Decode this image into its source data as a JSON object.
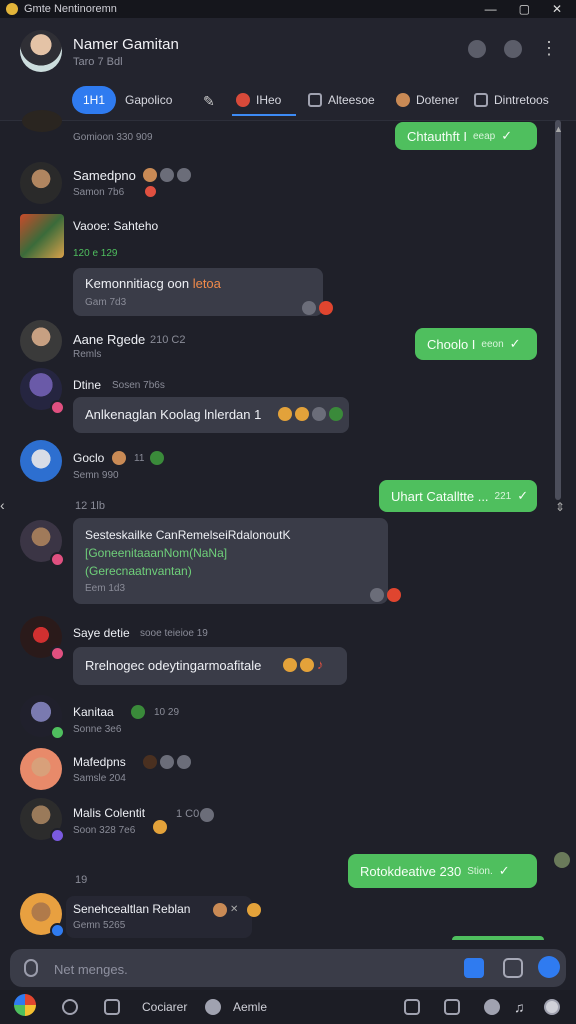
{
  "window": {
    "title": "Gmte Nentinoremn",
    "controls": [
      "—",
      "▢",
      "✕"
    ]
  },
  "header": {
    "name": "Namer Gamitan",
    "subtitle": "Taro 7 Bdl"
  },
  "tabs": [
    {
      "label": "1H1"
    },
    {
      "label": "Gapolico"
    },
    {
      "label": "IHeo"
    },
    {
      "label": "Alteesoe"
    },
    {
      "label": "Dotener"
    },
    {
      "label": "Dintretoos"
    }
  ],
  "messages": {
    "m0": {
      "time": "Gomioon 330 909"
    },
    "out1": {
      "text": "Chtauthft I",
      "time": "eeap",
      "status": "✓"
    },
    "m1": {
      "name": "Samedpno",
      "time": "Samon 7b6"
    },
    "m2": {
      "name": "Vaooe: Sahteho",
      "time": "120 e 129"
    },
    "b2": {
      "text": "Kemonnitiacg oon"
    },
    "b2b": {
      "text": "letoa",
      "time": "Gam 7d3"
    },
    "m3": {
      "name": "Aane Rgede",
      "extra": "210 C2",
      "time": "Remls"
    },
    "out2": {
      "text": "Choolo I",
      "time": "eeon",
      "status": "✓"
    },
    "m4": {
      "name": "Dtine",
      "extra": "Sosen 7b6s"
    },
    "b4": {
      "text": "Anlkenaglan Koolag lnlerdan 1"
    },
    "m5": {
      "name": "Goclo",
      "extra": "11",
      "time": "Semn 990"
    },
    "out3": {
      "text": "Uhart Catalltte ...",
      "time": "221",
      "status": "✓"
    },
    "m6": {
      "time": "12 1lb"
    },
    "b6": {
      "line1": "Sesteskailke CanRemelseiRdalonoutK",
      "line2": "[GoneenitaaanNom(NaNa]",
      "line3": "(Gerecnaatnvantan)",
      "time": "Eem 1d3"
    },
    "m7": {
      "name": "Saye detie",
      "extra": "sooe teieioe 19"
    },
    "b7": {
      "text": "Rrelnogec odeytingarmoafitale"
    },
    "m8": {
      "name": "Kanitaa",
      "extra": "10 29",
      "time": "Sonne 3e6"
    },
    "m9": {
      "name": "Mafedpns",
      "time": "Samsle 204"
    },
    "m10": {
      "name": "Malis Colentit",
      "extra": "1 C0",
      "time": "Soon 328 7e6"
    },
    "out4": {
      "text": "Rotokdeative 230",
      "time": "Stion.",
      "status": "✓"
    },
    "m11": {
      "time": "19"
    },
    "m12": {
      "name": "Senehcealtlan Reblan",
      "time": "Gemn 5265"
    }
  },
  "composer": {
    "placeholder": "Net menges."
  },
  "bottom": {
    "item1": "Cociarer",
    "item2": "Aemle"
  },
  "colors": {
    "accent": "#2f7bf0",
    "outgoing": "#4fbf5e",
    "background": "#1f2029"
  }
}
